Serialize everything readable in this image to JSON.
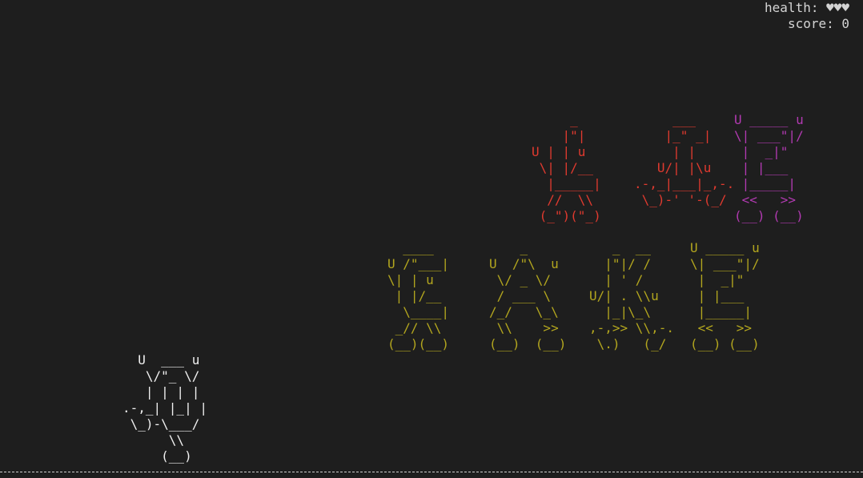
{
  "hud": {
    "health": "health: ♥♥♥",
    "score": "score: 0"
  },
  "colors": {
    "background": "#1e1e1e",
    "hud_text": "#d4d4d4",
    "player": "#f0f0f0",
    "letters_red": "#e03a2f",
    "letters_purple": "#b23ab2",
    "letters_olive": "#b3a61e",
    "ground": "#cfcfcf"
  },
  "player": {
    "art": "  U  ___ u\n   \\/\"_ \\/\n   | | | |\n.-,_| |_| |\n \\_)-\\___/\n      \\\\\n     (__)"
  },
  "letters_red": [
    {
      "id": "L",
      "art": "     _\n    |\"|\nU | | u\n \\| |/__\n  |_____|\n  //  \\\\\n (_\")(\"_)"
    },
    {
      "id": "A",
      "art": "     ___\n    |_\" _|\n     | |\n   U/| |\\u\n.-,_|___|_,-.\n \\_)-' '-(_/"
    }
  ],
  "letters_purple": [
    {
      "id": "E",
      "art": "U _____ u\n\\| ___\"|/\n |  _|\"\n | |___\n |_____|\n <<   >>\n(__) (__)"
    }
  ],
  "letters_olive": [
    {
      "id": "S",
      "art": "  ____\nU /\"___|\n\\| | u\n | |/__\n  \\____|\n _// \\\\\n(__)(__)"
    },
    {
      "id": "A2",
      "art": "    _\nU  /\"\\  u\n \\/ _ \\/\n / ___ \\\n/_/   \\_\\\n \\\\    >>\n(__)  (__)"
    },
    {
      "id": "K",
      "art": "   _  __\n  |\"|/ /\n  | ' /\nU/| . \\\\u\n  |_|\\_\\\n,-,>> \\\\,-.\n \\.)   (_/"
    },
    {
      "id": "E2",
      "art": "U _____ u\n\\| ___\"|/\n |  _|\"\n | |___\n |_____|\n <<   >>\n(__) (__)"
    }
  ]
}
